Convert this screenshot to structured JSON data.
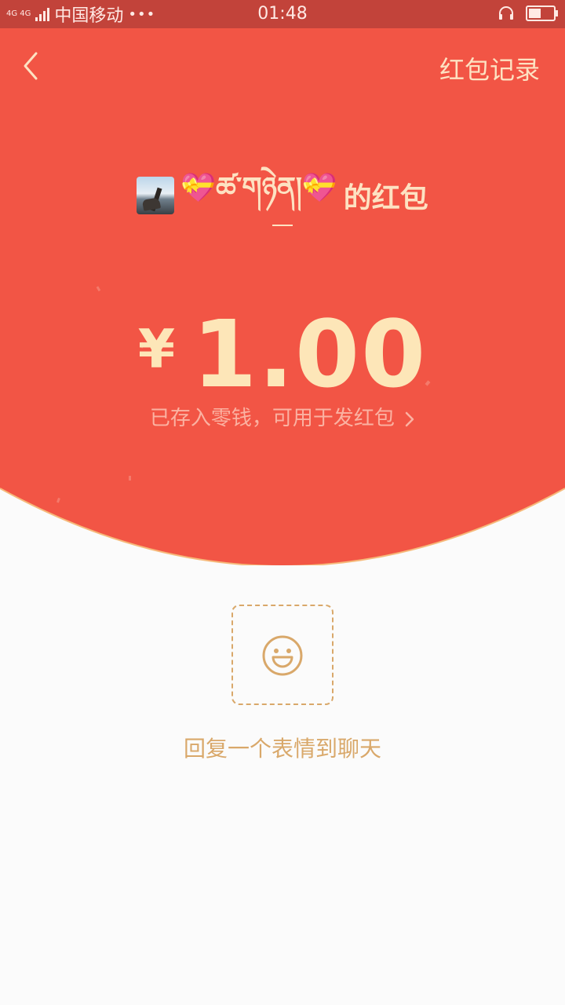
{
  "status_bar": {
    "network_label": "4G 4G",
    "carrier": "中国移动",
    "more": "•••",
    "time": "01:48",
    "battery_level": 0.55
  },
  "header": {
    "back_icon": "chevron-left-icon",
    "records_label": "红包记录"
  },
  "sender": {
    "name": "💝ཚ་གཉེན།💝",
    "suffix": "的红包"
  },
  "amount": {
    "currency": "¥",
    "value": "1.00"
  },
  "saved_note": "已存入零钱，可用于发红包",
  "reply": {
    "icon": "smiley-icon",
    "label": "回复一个表情到聊天"
  },
  "colors": {
    "red": "#f25545",
    "status_bar": "#c2433a",
    "gold_text": "#fde6b8",
    "reply_gold": "#d9a86a",
    "background": "#fbfbfb"
  }
}
